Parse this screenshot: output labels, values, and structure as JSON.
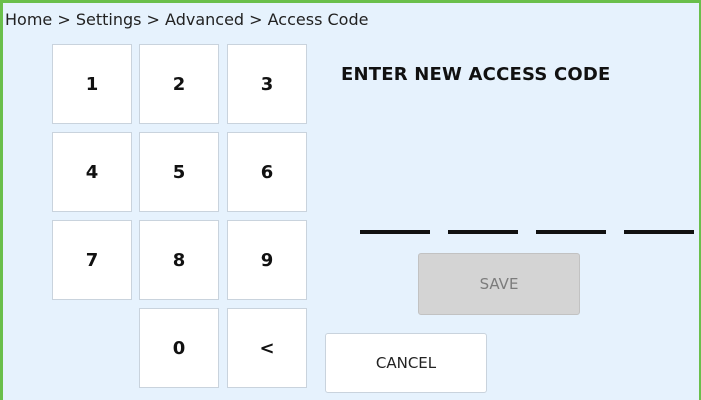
{
  "breadcrumb": "Home > Settings > Advanced > Access Code",
  "title": "ENTER NEW ACCESS CODE",
  "keypad": {
    "k1": "1",
    "k2": "2",
    "k3": "3",
    "k4": "4",
    "k5": "5",
    "k6": "6",
    "k7": "7",
    "k8": "8",
    "k9": "9",
    "k0": "0",
    "backspace": "<"
  },
  "code_digits_entered": 0,
  "code_length": 4,
  "buttons": {
    "save": "SAVE",
    "save_enabled": false,
    "cancel": "CANCEL"
  },
  "colors": {
    "background": "#e6f2fd",
    "frame": "#6abf4b",
    "key_background": "#ffffff",
    "disabled_button": "#d4d4d4"
  }
}
